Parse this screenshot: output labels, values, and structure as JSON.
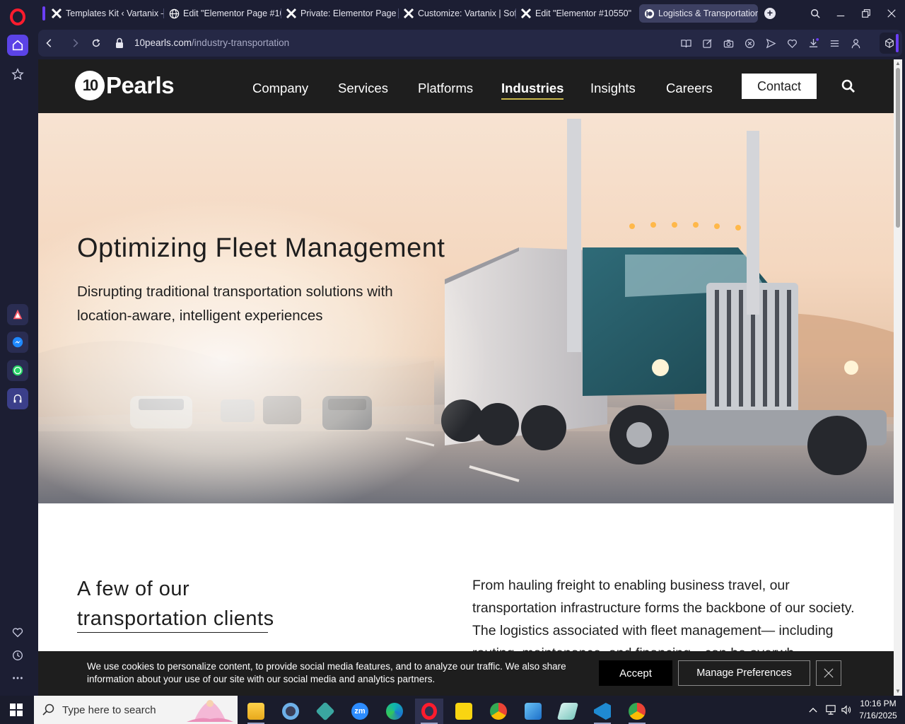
{
  "browser": {
    "tabs": [
      {
        "label": "Templates Kit ‹ Vartanix —",
        "icon": "elementor-x-icon"
      },
      {
        "label": "Edit \"Elementor Page #10",
        "icon": "globe-icon"
      },
      {
        "label": "Private: Elementor Page #",
        "icon": "elementor-x-icon"
      },
      {
        "label": "Customize: Vartanix | Soft",
        "icon": "elementor-x-icon"
      },
      {
        "label": "Edit \"Elementor #10550\" ",
        "icon": "elementor-x-icon"
      },
      {
        "label": "Logistics & Transportation",
        "icon": "10pearls-icon",
        "active": true
      }
    ],
    "new_tab_label": "+",
    "url_domain": "10pearls.com",
    "url_path": "/industry-transportation"
  },
  "site": {
    "logo_mark": "10",
    "logo_word": "Pearls",
    "nav": [
      "Company",
      "Services",
      "Platforms",
      "Industries",
      "Insights",
      "Careers"
    ],
    "active_nav": "Industries",
    "contact_label": "Contact"
  },
  "hero": {
    "title": "Optimizing Fleet Management",
    "subtitle": "Disrupting traditional transportation solutions with location-aware, intelligent experiences"
  },
  "clients": {
    "heading_line1": "A few of our",
    "heading_line2": "transportation clients"
  },
  "body": {
    "text": "From hauling freight to enabling business travel, our transportation infrastructure forms the backbone of our society. The logistics associated with fleet management— including routing, maintenance, and financing—can be overwh"
  },
  "cookie": {
    "text": "We use cookies to personalize content, to provide social media features, and to analyze our traffic. We also share information about your use of our site with our social media and analytics partners.",
    "accept_label": "Accept",
    "manage_label": "Manage Preferences"
  },
  "taskbar": {
    "search_placeholder": "Type here to search",
    "time": "10:16 PM",
    "date": "7/16/2025"
  },
  "colors": {
    "opera_red": "#ff1b2d",
    "opera_accent": "#5b43e6",
    "site_header": "#1e1e1e",
    "nav_underline": "#c9b74a"
  }
}
